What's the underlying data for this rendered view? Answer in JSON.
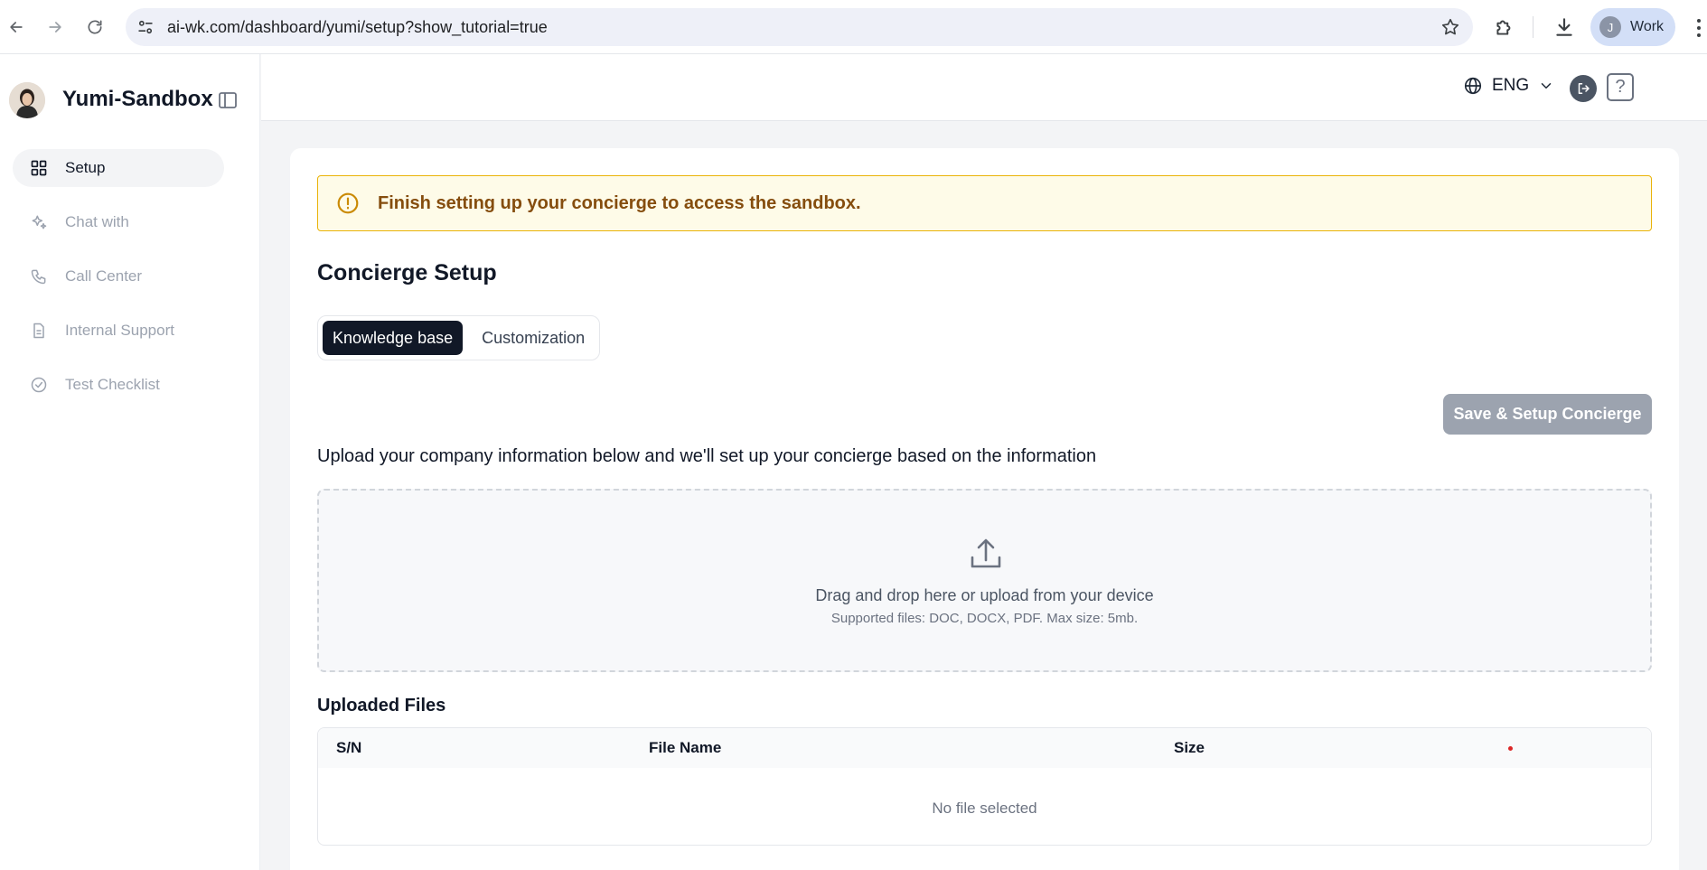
{
  "browser": {
    "url": "ai-wk.com/dashboard/yumi/setup?show_tutorial=true",
    "profile_initial": "J",
    "profile_label": "Work"
  },
  "sidebar": {
    "brand": "Yumi-Sandbox",
    "items": [
      {
        "label": "Setup",
        "icon": "grid-icon",
        "active": true
      },
      {
        "label": "Chat with",
        "icon": "sparkles-icon",
        "active": false
      },
      {
        "label": "Call Center",
        "icon": "phone-icon",
        "active": false
      },
      {
        "label": "Internal Support",
        "icon": "document-icon",
        "active": false
      },
      {
        "label": "Test Checklist",
        "icon": "check-circle-icon",
        "active": false
      }
    ]
  },
  "header": {
    "language": "ENG",
    "help_symbol": "?"
  },
  "main": {
    "alert": "Finish setting up your concierge to access the sandbox.",
    "title": "Concierge Setup",
    "tabs": [
      {
        "label": "Knowledge base",
        "active": true
      },
      {
        "label": "Customization",
        "active": false
      }
    ],
    "save_button": "Save & Setup Concierge",
    "upload_intro": "Upload your company information below and we'll set up your concierge based on the information",
    "dropzone": {
      "main_text": "Drag and drop here or upload from your device",
      "sub_text": "Supported files: DOC, DOCX, PDF. Max size: 5mb."
    },
    "files_title": "Uploaded Files",
    "table": {
      "columns": [
        "S/N",
        "File Name",
        "Size"
      ],
      "empty_text": "No file selected"
    }
  },
  "colors": {
    "accent_dark": "#111827",
    "alert_bg": "#fefbe8",
    "alert_border": "#eab308",
    "alert_text": "#854d0e",
    "disabled_button": "#9ca3af"
  }
}
